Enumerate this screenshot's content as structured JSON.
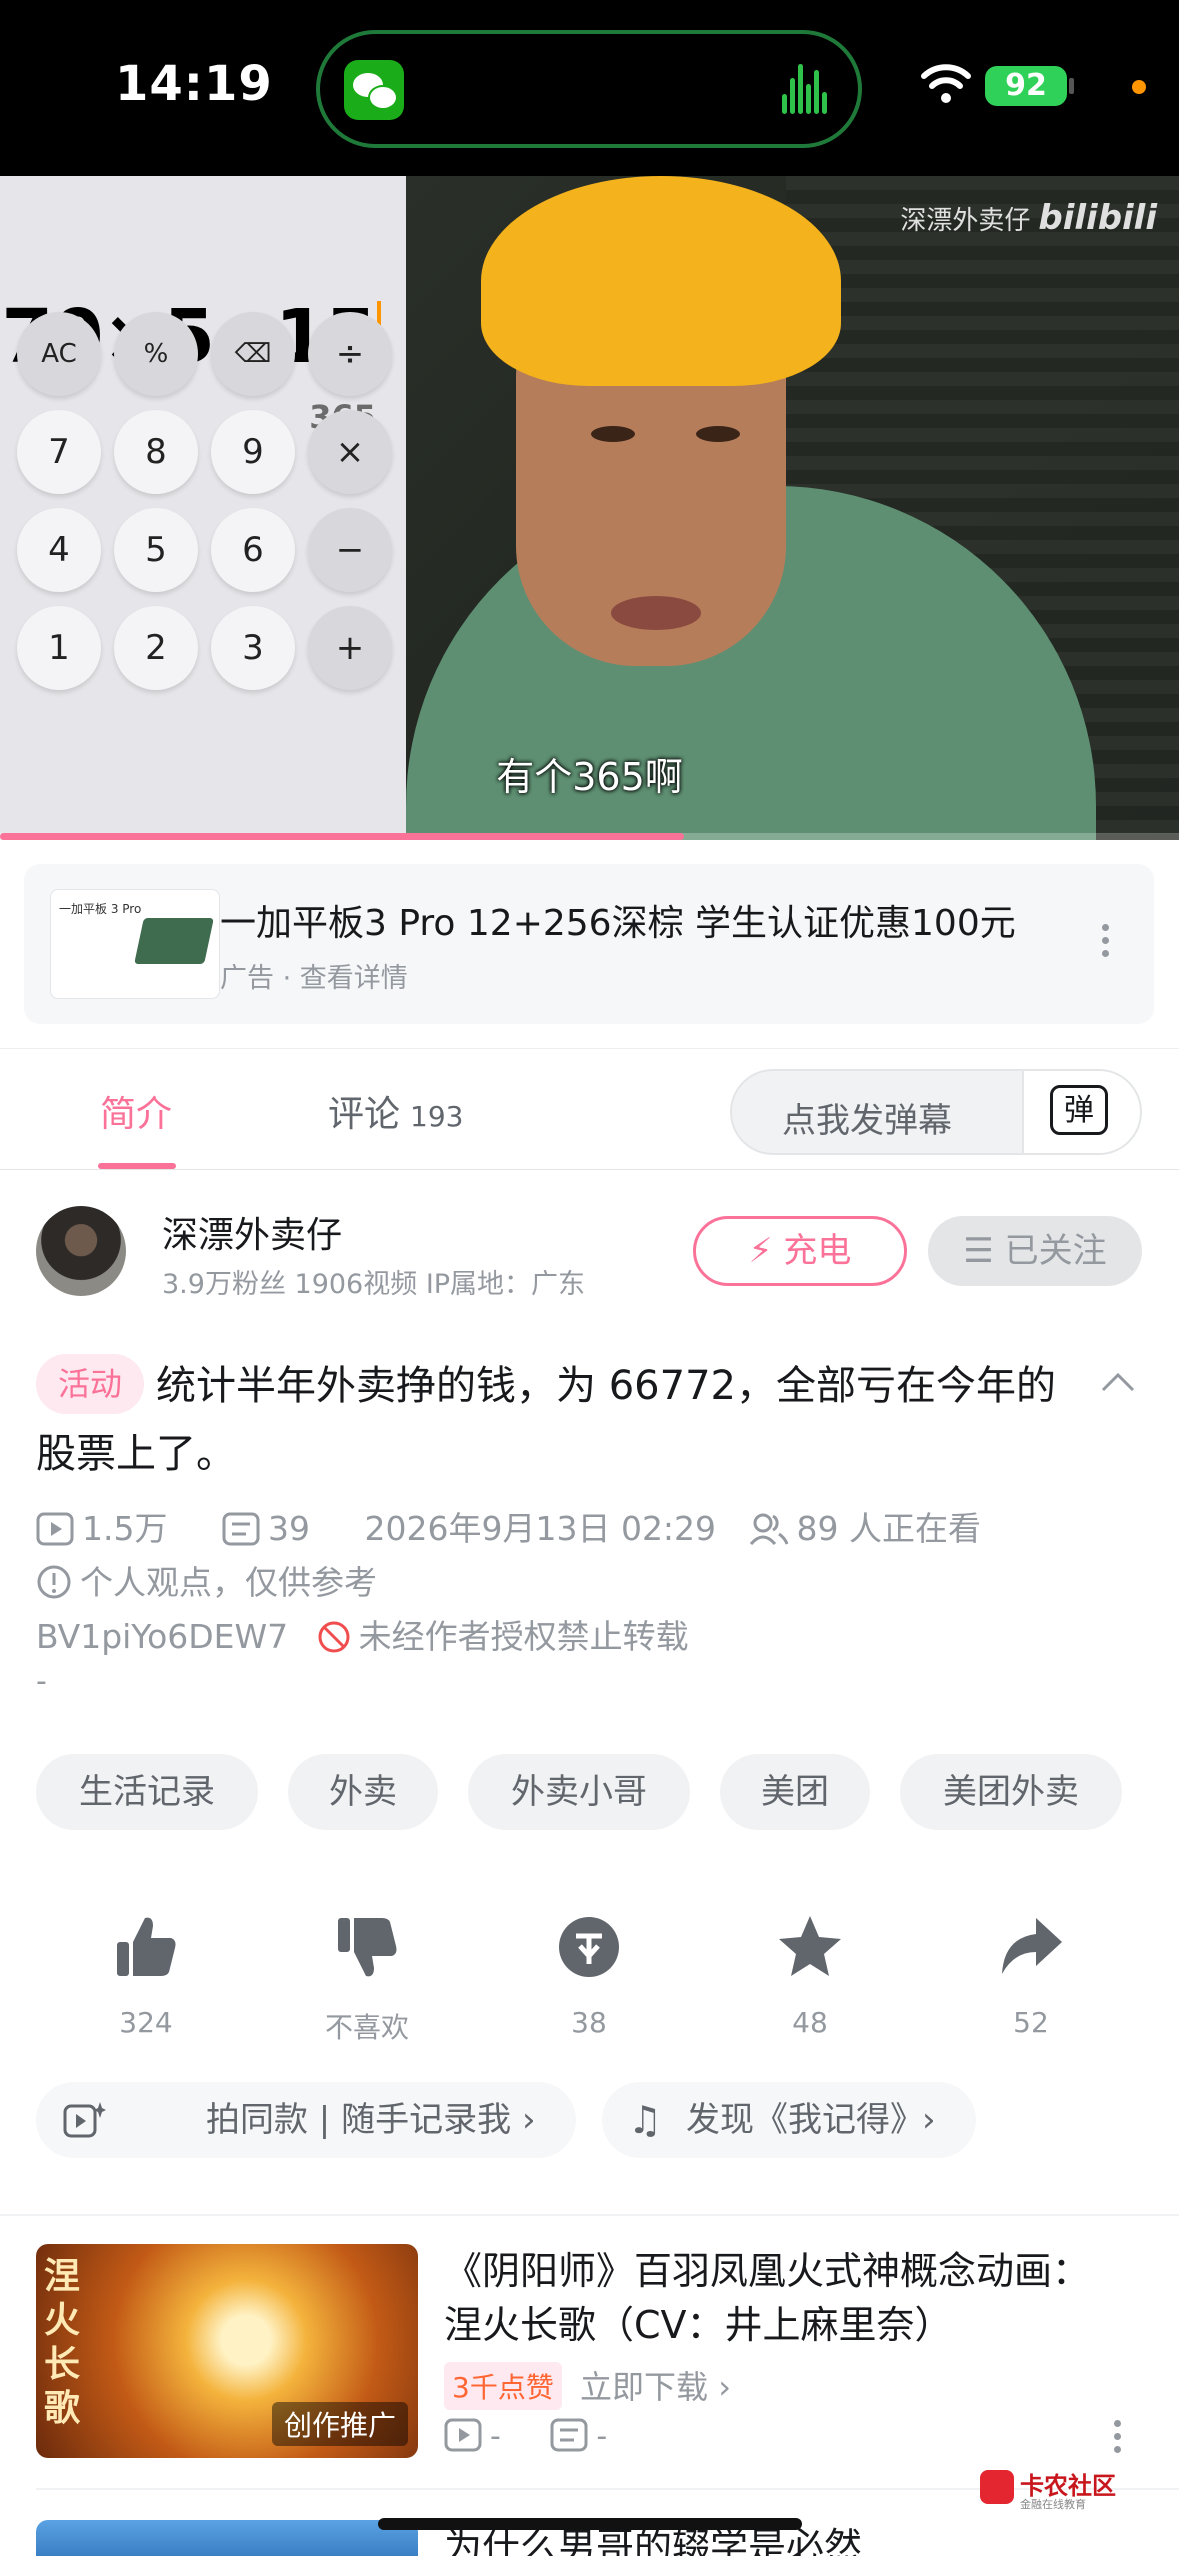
{
  "status_bar": {
    "time": "14:19",
    "battery": "92"
  },
  "video": {
    "calculator": {
      "expression": "70×5+15",
      "result": "365",
      "keys": [
        "AC",
        "%",
        "⌫",
        "÷",
        "7",
        "8",
        "9",
        "×",
        "4",
        "5",
        "6",
        "−",
        "1",
        "2",
        "3",
        "+"
      ]
    },
    "watermark_name": "深漂外卖仔",
    "watermark_brand": "bilibili",
    "subtitle": "有个365啊",
    "progress": 0.58
  },
  "ad": {
    "title": "一加平板3 Pro 12+256深棕 学生认证优惠100元",
    "subtitle": "广告 · 查看详情",
    "thumb_text": "一加平板 3 Pro"
  },
  "tabs": {
    "intro": "简介",
    "comments": "评论",
    "comments_count": "193",
    "danmaku_placeholder": "点我发弹幕",
    "danmaku_icon": "弹"
  },
  "uploader": {
    "name": "深漂外卖仔",
    "stats": "3.9万粉丝  1906视频  IP属地：广东",
    "charge_label": "充电",
    "follow_label": "已关注"
  },
  "video_info": {
    "activity_badge": "活动",
    "title": "统计半年外卖挣的钱，为 66772，全部亏在今年的股票上了。",
    "plays": "1.5万",
    "danmaku_count": "39",
    "date": "2026年9月13日 02:29",
    "watching": "89 人正在看",
    "notice": "个人观点，仅供参考",
    "bvid": "BV1piYo6DEW7",
    "no_repost": "未经作者授权禁止转载",
    "desc": "-"
  },
  "tags": [
    "生活记录",
    "外卖",
    "外卖小哥",
    "美团",
    "美团外卖"
  ],
  "actions": {
    "like": "324",
    "dislike": "不喜欢",
    "coin": "38",
    "favorite": "48",
    "share": "52"
  },
  "chips": {
    "same_style": "拍同款 | 随手记录我",
    "music": "发现《我记得》"
  },
  "related": {
    "thumb_title": "涅火长歌",
    "thumb_badge": "创作推广",
    "title": "《阴阳师》百羽凤凰火式神概念动画：涅火长歌（CV：井上麻里奈）",
    "likes_badge": "3千点赞",
    "download": "立即下载",
    "plays": "-",
    "comments": "-"
  },
  "next_related": {
    "title": "为什么男哥的辍学是必然"
  },
  "watermark_site": {
    "name": "卡农社区",
    "sub": "金融在线教育"
  },
  "colors": {
    "accent": "#fb7299",
    "muted": "#9499a0",
    "text": "#18191c"
  }
}
